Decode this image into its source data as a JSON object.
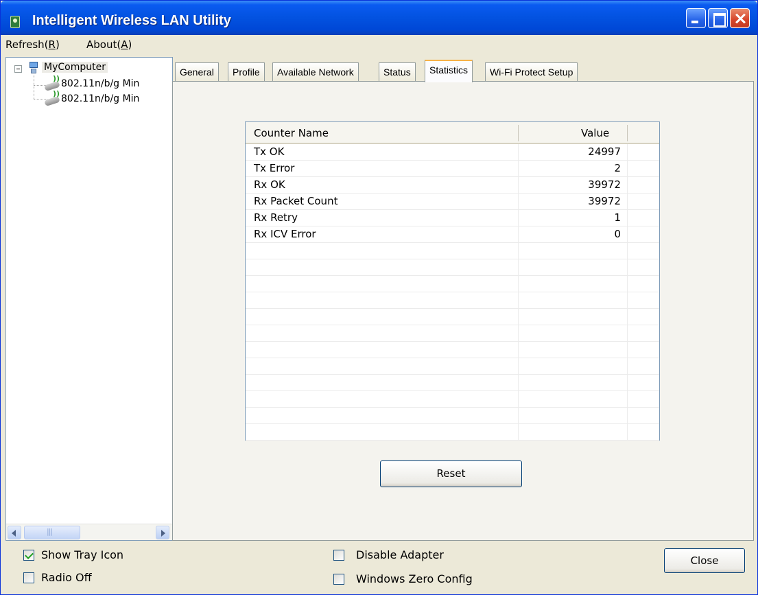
{
  "window": {
    "title": "Intelligent Wireless LAN Utility"
  },
  "menu": {
    "refresh": {
      "prefix": "Refresh(",
      "accel": "R",
      "suffix": ")"
    },
    "about": {
      "prefix": "About(",
      "accel": "A",
      "suffix": ")"
    }
  },
  "tree": {
    "root": "MyComputer",
    "children": [
      "802.11n/b/g Min",
      "802.11n/b/g Min"
    ]
  },
  "tabs": [
    "General",
    "Profile",
    "Available Network",
    "Status",
    "Statistics",
    "Wi-Fi Protect Setup"
  ],
  "active_tab": "Statistics",
  "statistics": {
    "columns": {
      "name": "Counter Name",
      "value": "Value"
    },
    "rows": [
      {
        "name": "Tx OK",
        "value": "24997"
      },
      {
        "name": "Tx Error",
        "value": "2"
      },
      {
        "name": "Rx OK",
        "value": "39972"
      },
      {
        "name": "Rx Packet Count",
        "value": "39972"
      },
      {
        "name": "Rx Retry",
        "value": "1"
      },
      {
        "name": "Rx ICV Error",
        "value": "0"
      }
    ]
  },
  "buttons": {
    "reset": "Reset",
    "close": "Close"
  },
  "options": {
    "show_tray_icon": {
      "label": "Show Tray Icon",
      "checked": true
    },
    "radio_off": {
      "label": "Radio Off",
      "checked": false
    },
    "disable_adapter": {
      "label": "Disable Adapter",
      "checked": false
    },
    "windows_zero_config": {
      "label": "Windows Zero Config",
      "checked": false
    }
  }
}
